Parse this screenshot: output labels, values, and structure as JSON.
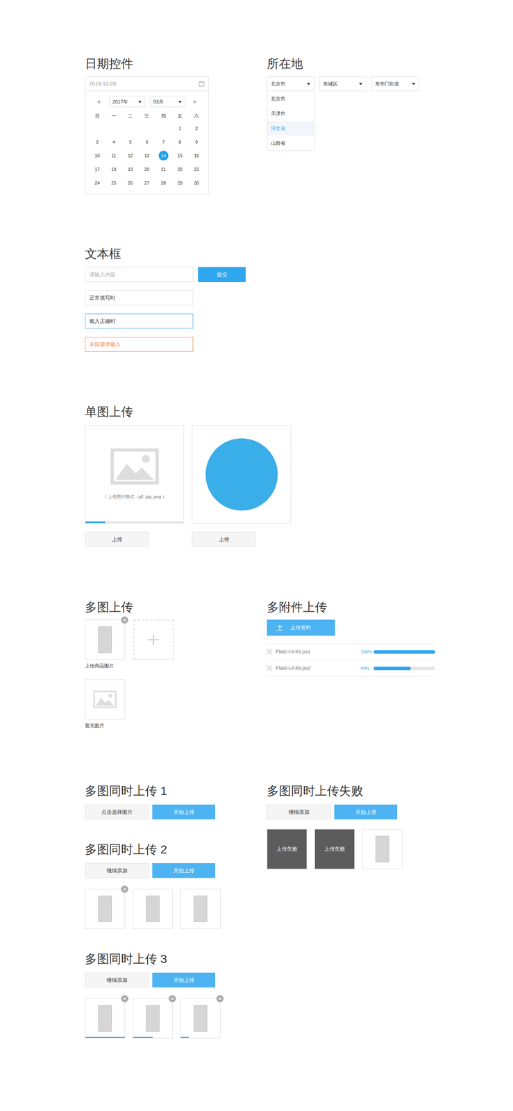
{
  "date_picker": {
    "title": "日期控件",
    "value": "2016-12-28",
    "year": "2017年",
    "month": "03月",
    "weekdays": [
      "日",
      "一",
      "二",
      "三",
      "四",
      "五",
      "六"
    ],
    "weeks": [
      [
        {
          "day": "",
          "selected": false
        },
        {
          "day": "",
          "selected": false
        },
        {
          "day": "",
          "selected": false
        },
        {
          "day": "",
          "selected": false
        },
        {
          "day": "",
          "selected": false
        },
        {
          "day": "1",
          "selected": false
        },
        {
          "day": "2",
          "selected": false
        }
      ],
      [
        {
          "day": "3",
          "selected": false
        },
        {
          "day": "4",
          "selected": false
        },
        {
          "day": "5",
          "selected": false
        },
        {
          "day": "6",
          "selected": false
        },
        {
          "day": "7",
          "selected": false
        },
        {
          "day": "8",
          "selected": false
        },
        {
          "day": "9",
          "selected": false
        }
      ],
      [
        {
          "day": "10",
          "selected": false
        },
        {
          "day": "11",
          "selected": false
        },
        {
          "day": "12",
          "selected": false
        },
        {
          "day": "13",
          "selected": false
        },
        {
          "day": "14",
          "selected": true
        },
        {
          "day": "15",
          "selected": false
        },
        {
          "day": "16",
          "selected": false
        }
      ],
      [
        {
          "day": "17",
          "selected": false
        },
        {
          "day": "18",
          "selected": false
        },
        {
          "day": "19",
          "selected": false
        },
        {
          "day": "20",
          "selected": false
        },
        {
          "day": "21",
          "selected": false
        },
        {
          "day": "22",
          "selected": false
        },
        {
          "day": "23",
          "selected": false
        }
      ],
      [
        {
          "day": "24",
          "selected": false
        },
        {
          "day": "25",
          "selected": false
        },
        {
          "day": "26",
          "selected": false
        },
        {
          "day": "27",
          "selected": false
        },
        {
          "day": "28",
          "selected": false
        },
        {
          "day": "29",
          "selected": false
        },
        {
          "day": "30",
          "selected": false
        }
      ]
    ]
  },
  "location": {
    "title": "所在地",
    "selects": [
      "北京市",
      "东城区",
      "东华门街道"
    ],
    "options": [
      {
        "label": "北京市",
        "selected": false
      },
      {
        "label": "天津市",
        "selected": false
      },
      {
        "label": "河北省",
        "selected": true
      },
      {
        "label": "山西省",
        "selected": false
      }
    ]
  },
  "text_fields": {
    "title": "文本框",
    "submit": "提交",
    "fields": [
      {
        "value": "请输入内容",
        "kind": "placeholder"
      },
      {
        "value": "正常填写时",
        "kind": "normal"
      },
      {
        "value": "输入正确时",
        "kind": "valid"
      },
      {
        "value": "未按需求输入",
        "kind": "error"
      }
    ]
  },
  "single_upload": {
    "title": "单图上传",
    "items": [
      {
        "kind": "empty",
        "hint": "（ 上传图片格式：gif, jpg, png ）",
        "level": 0.2,
        "button": "上传"
      },
      {
        "kind": "photo",
        "button": "上传"
      }
    ]
  },
  "multi_upload": {
    "title": "多图上传",
    "image": {
      "caption": "上传商品图片",
      "removable": true
    },
    "empty": {
      "caption": "暂无图片"
    }
  },
  "attachments": {
    "title": "多附件上传",
    "button": "上传资料",
    "files": [
      {
        "name": "Flatic-UI-Kit.psd",
        "reading": "100%",
        "level": 1
      },
      {
        "name": "Flatic-UI-Kit.psd",
        "reading": "60%",
        "level": 0.6
      }
    ]
  },
  "batch_uploads": [
    {
      "title": "多图同时上传 1",
      "buttons": [
        "点击选择图片",
        "开始上传"
      ],
      "images": []
    },
    {
      "title": "多图同时上传 2",
      "buttons": [
        "继续添加",
        "开始上传"
      ],
      "images": [
        {
          "removable": true,
          "failed": false
        },
        {
          "removable": false,
          "failed": false
        },
        {
          "removable": false,
          "failed": false
        }
      ]
    },
    {
      "title": "多图同时上传 3",
      "buttons": [
        "继续添加",
        "开始上传"
      ],
      "images": [
        {
          "removable": true,
          "failed": false,
          "level": 1
        },
        {
          "removable": true,
          "failed": false,
          "level": 0.5
        },
        {
          "removable": true,
          "failed": false,
          "level": 0.2
        }
      ]
    }
  ],
  "failed_upload": {
    "title": "多图同时上传失败",
    "buttons": [
      "继续添加",
      "开始上传"
    ],
    "images": [
      {
        "removable": false,
        "failed": true,
        "label": "上传失败"
      },
      {
        "removable": false,
        "failed": true,
        "label": "上传失败"
      },
      {
        "removable": false,
        "failed": false
      }
    ]
  }
}
